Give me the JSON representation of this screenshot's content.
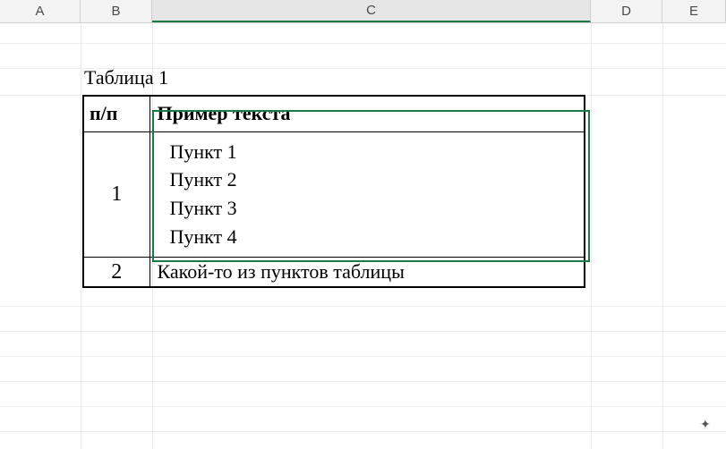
{
  "columns": {
    "A": "A",
    "B": "B",
    "C": "C",
    "D": "D",
    "E": "E"
  },
  "title": "Таблица 1",
  "table": {
    "header": {
      "pp": "п/п",
      "example": "Пример текста"
    },
    "rows": [
      {
        "num": "1",
        "items": [
          "Пункт 1",
          "Пункт 2",
          "Пункт 3",
          "Пункт 4"
        ]
      },
      {
        "num": "2",
        "text": "Какой-то из пунктов таблицы"
      }
    ]
  },
  "selected_column": "C",
  "cursor_glyph": "✦"
}
